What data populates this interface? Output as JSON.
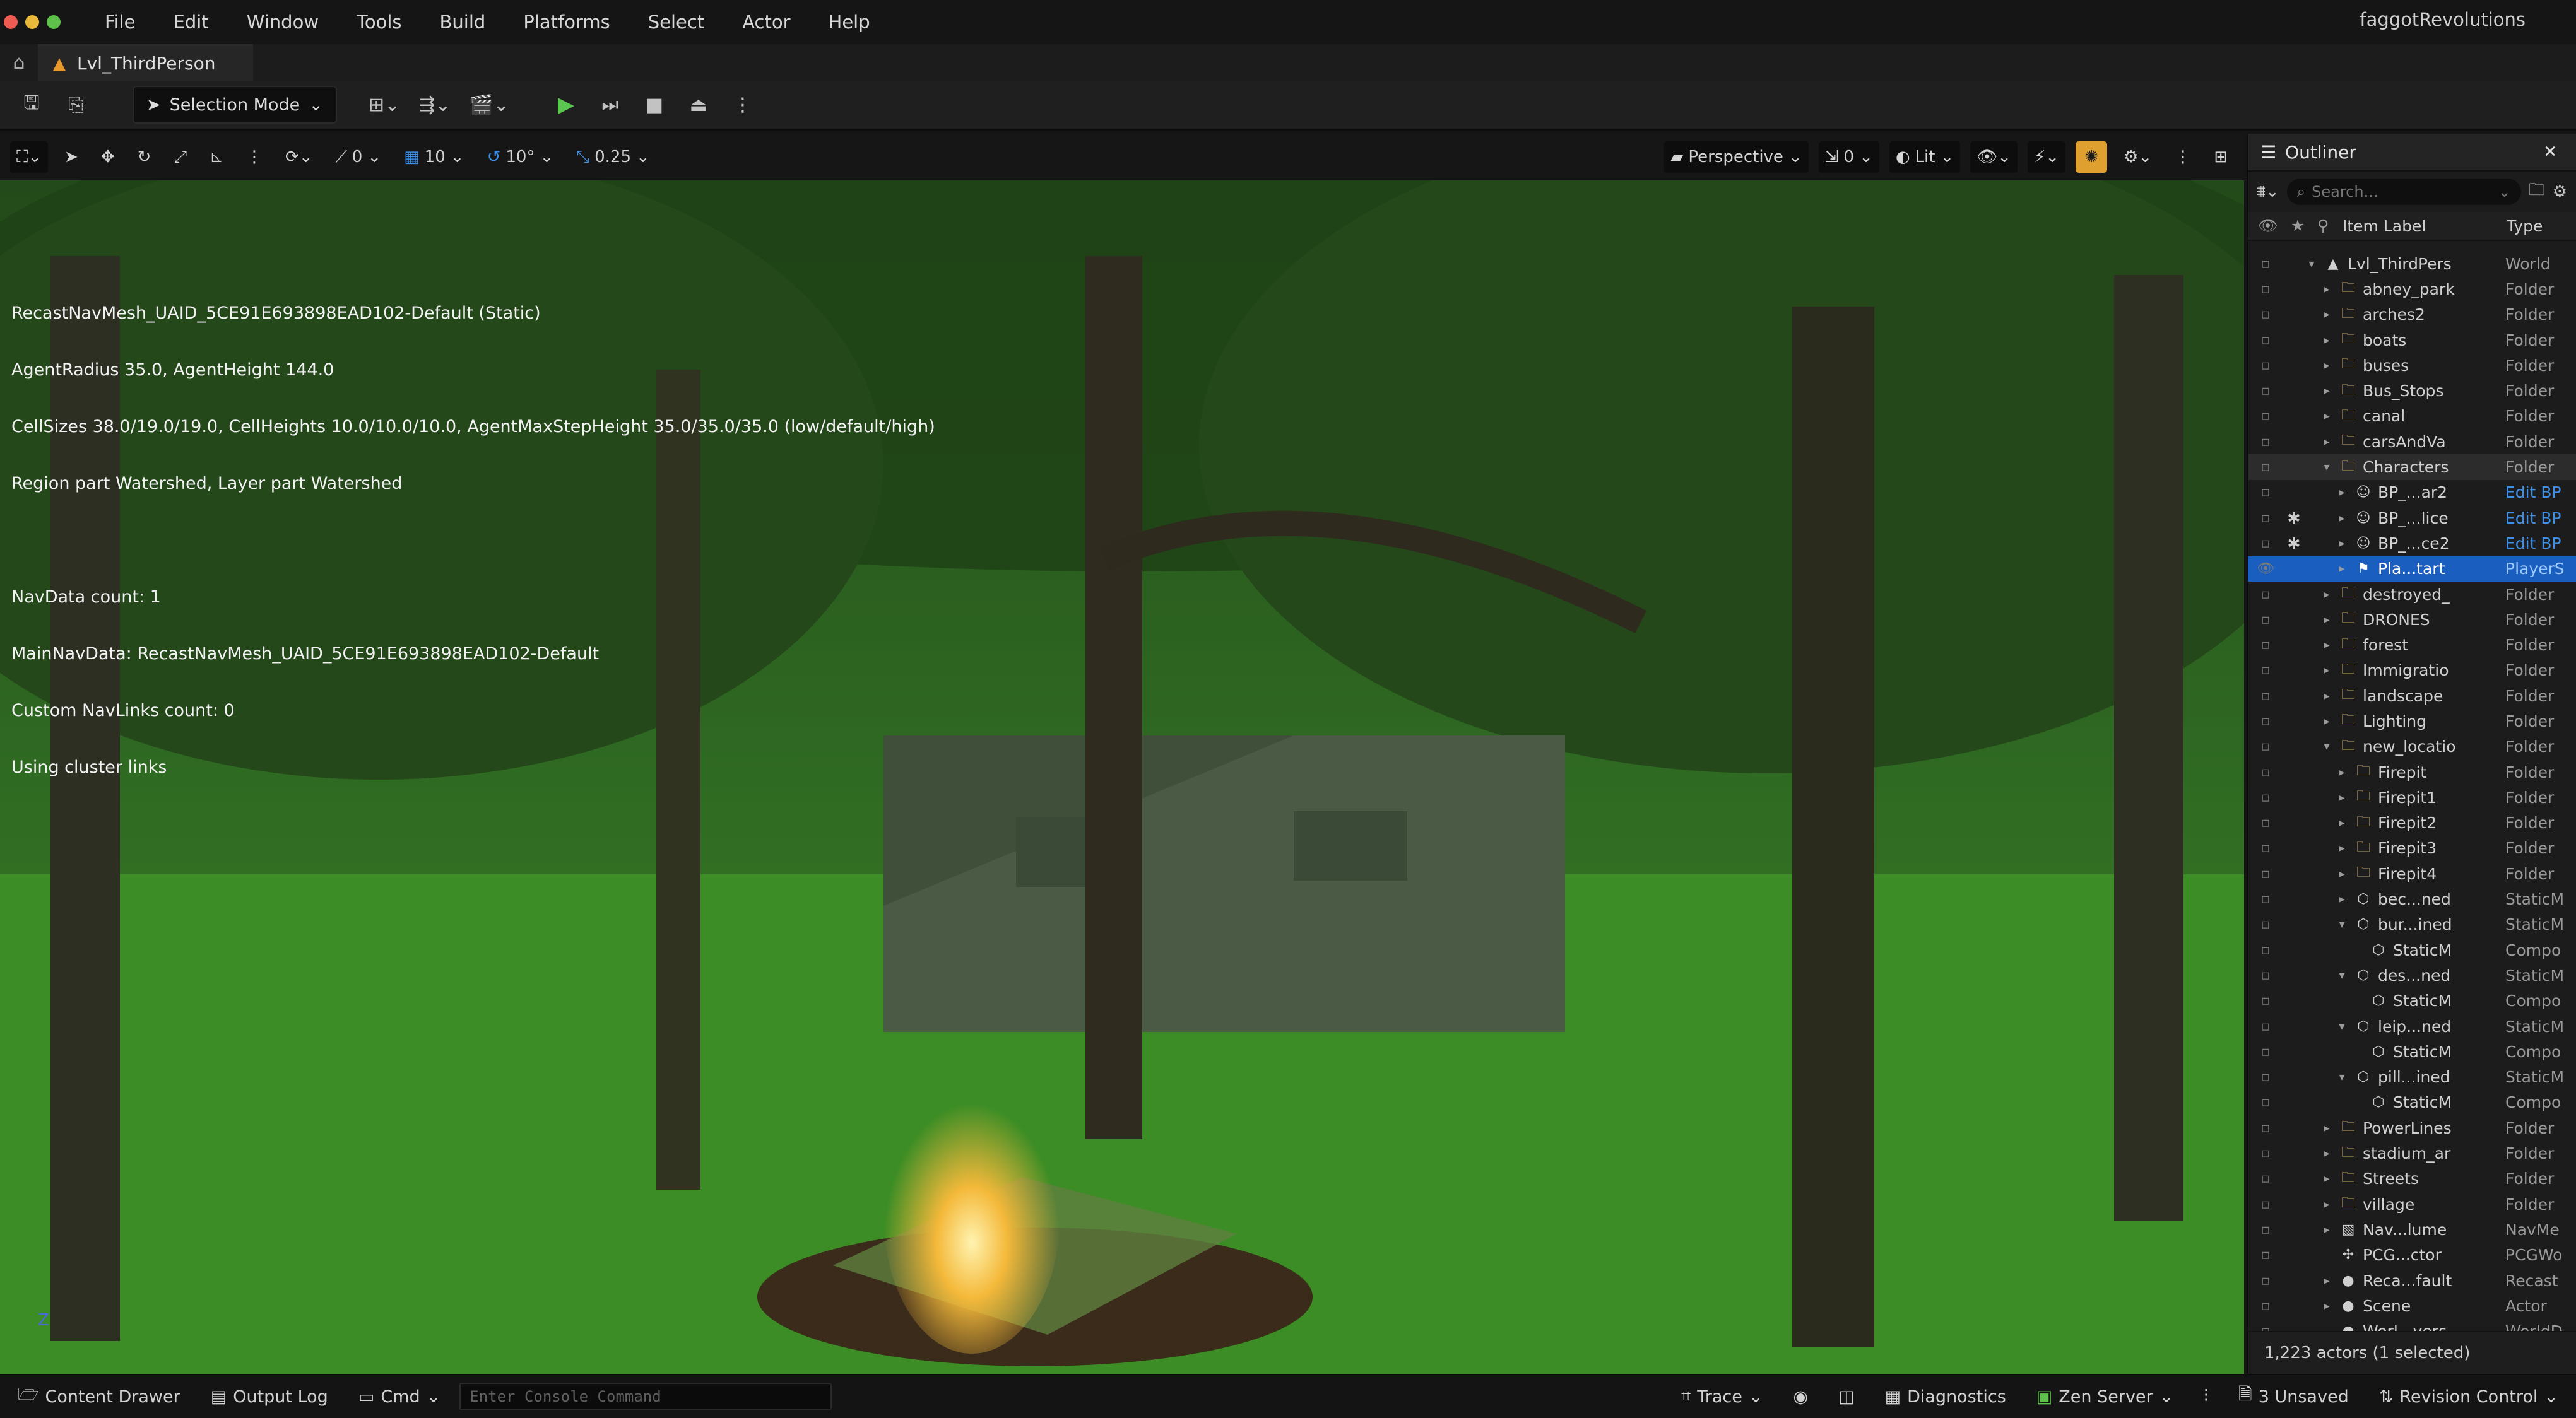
{
  "menubar": {
    "items": [
      "File",
      "Edit",
      "Window",
      "Tools",
      "Build",
      "Platforms",
      "Select",
      "Actor",
      "Help"
    ],
    "project": "faggotRevolutions"
  },
  "tabs": {
    "level_tab": "Lvl_ThirdPerson"
  },
  "toolbar": {
    "selection_mode": "Selection Mode"
  },
  "viewport_toolbar": {
    "rotation_snap": "0",
    "grid_snap": "10",
    "angle_snap": "10°",
    "scale_snap": "0.25",
    "view_mode": "Perspective",
    "camera_speed": "0",
    "lighting": "Lit"
  },
  "stats": [
    "RecastNavMesh_UAID_5CE91E693898EAD102-Default (Static)",
    "AgentRadius 35.0, AgentHeight 144.0",
    "CellSizes 38.0/19.0/19.0, CellHeights 10.0/10.0/10.0, AgentMaxStepHeight 35.0/35.0/35.0 (low/default/high)",
    "Region part Watershed, Layer part Watershed",
    "",
    "NavData count: 1",
    "MainNavData: RecastNavMesh_UAID_5CE91E693898EAD102-Default",
    "Custom NavLinks count: 0",
    "Using cluster links"
  ],
  "axis_label": "Z",
  "outliner": {
    "title": "Outliner",
    "search_placeholder": "Search...",
    "col_label": "Item Label",
    "col_type": "Type",
    "footer": "1,223 actors (1 selected)",
    "rows": [
      {
        "indent": 0,
        "arrow": "▾",
        "icon": "world",
        "label": "Lvl_ThirdPers",
        "type": "World",
        "star": "",
        "state": ""
      },
      {
        "indent": 1,
        "arrow": "▸",
        "icon": "folder",
        "label": "abney_park",
        "type": "Folder",
        "star": "",
        "state": ""
      },
      {
        "indent": 1,
        "arrow": "▸",
        "icon": "folder",
        "label": "arches2",
        "type": "Folder",
        "star": "",
        "state": ""
      },
      {
        "indent": 1,
        "arrow": "▸",
        "icon": "folder",
        "label": "boats",
        "type": "Folder",
        "star": "",
        "state": ""
      },
      {
        "indent": 1,
        "arrow": "▸",
        "icon": "folder",
        "label": "buses",
        "type": "Folder",
        "star": "",
        "state": ""
      },
      {
        "indent": 1,
        "arrow": "▸",
        "icon": "folder",
        "label": "Bus_Stops",
        "type": "Folder",
        "star": "",
        "state": ""
      },
      {
        "indent": 1,
        "arrow": "▸",
        "icon": "folder",
        "label": "canal",
        "type": "Folder",
        "star": "",
        "state": ""
      },
      {
        "indent": 1,
        "arrow": "▸",
        "icon": "folder",
        "label": "carsAndVa",
        "type": "Folder",
        "star": "",
        "state": ""
      },
      {
        "indent": 1,
        "arrow": "▾",
        "icon": "folder",
        "label": "Characters",
        "type": "Folder",
        "star": "",
        "state": "hi"
      },
      {
        "indent": 2,
        "arrow": "▸",
        "icon": "pawn",
        "label": "BP_...ar2",
        "type": "Edit BP",
        "star": "",
        "state": ""
      },
      {
        "indent": 2,
        "arrow": "▸",
        "icon": "pawn",
        "label": "BP_...lice",
        "type": "Edit BP",
        "star": "✱",
        "state": ""
      },
      {
        "indent": 2,
        "arrow": "▸",
        "icon": "pawn",
        "label": "BP_...ce2",
        "type": "Edit BP",
        "star": "✱",
        "state": ""
      },
      {
        "indent": 2,
        "arrow": "▸",
        "icon": "start",
        "label": "Pla...tart",
        "type": "PlayerS",
        "star": "",
        "state": "sel"
      },
      {
        "indent": 1,
        "arrow": "▸",
        "icon": "folder",
        "label": "destroyed_",
        "type": "Folder",
        "star": "",
        "state": ""
      },
      {
        "indent": 1,
        "arrow": "▸",
        "icon": "folder",
        "label": "DRONES",
        "type": "Folder",
        "star": "",
        "state": ""
      },
      {
        "indent": 1,
        "arrow": "▸",
        "icon": "folder",
        "label": "forest",
        "type": "Folder",
        "star": "",
        "state": ""
      },
      {
        "indent": 1,
        "arrow": "▸",
        "icon": "folder",
        "label": "Immigratio",
        "type": "Folder",
        "star": "",
        "state": ""
      },
      {
        "indent": 1,
        "arrow": "▸",
        "icon": "folder",
        "label": "landscape",
        "type": "Folder",
        "star": "",
        "state": ""
      },
      {
        "indent": 1,
        "arrow": "▸",
        "icon": "folder",
        "label": "Lighting",
        "type": "Folder",
        "star": "",
        "state": ""
      },
      {
        "indent": 1,
        "arrow": "▾",
        "icon": "folder",
        "label": "new_locatio",
        "type": "Folder",
        "star": "",
        "state": ""
      },
      {
        "indent": 2,
        "arrow": "▸",
        "icon": "folder",
        "label": "Firepit",
        "type": "Folder",
        "star": "",
        "state": ""
      },
      {
        "indent": 2,
        "arrow": "▸",
        "icon": "folder",
        "label": "Firepit1",
        "type": "Folder",
        "star": "",
        "state": ""
      },
      {
        "indent": 2,
        "arrow": "▸",
        "icon": "folder",
        "label": "Firepit2",
        "type": "Folder",
        "star": "",
        "state": ""
      },
      {
        "indent": 2,
        "arrow": "▸",
        "icon": "folder",
        "label": "Firepit3",
        "type": "Folder",
        "star": "",
        "state": ""
      },
      {
        "indent": 2,
        "arrow": "▸",
        "icon": "folder",
        "label": "Firepit4",
        "type": "Folder",
        "star": "",
        "state": ""
      },
      {
        "indent": 2,
        "arrow": "▸",
        "icon": "mesh",
        "label": "bec...ned",
        "type": "StaticM",
        "star": "",
        "state": ""
      },
      {
        "indent": 2,
        "arrow": "▾",
        "icon": "mesh",
        "label": "bur...ined",
        "type": "StaticM",
        "star": "",
        "state": ""
      },
      {
        "indent": 3,
        "arrow": "",
        "icon": "mesh",
        "label": "StaticM",
        "type": "Compo",
        "star": "",
        "state": ""
      },
      {
        "indent": 2,
        "arrow": "▾",
        "icon": "mesh",
        "label": "des...ned",
        "type": "StaticM",
        "star": "",
        "state": ""
      },
      {
        "indent": 3,
        "arrow": "",
        "icon": "mesh",
        "label": "StaticM",
        "type": "Compo",
        "star": "",
        "state": ""
      },
      {
        "indent": 2,
        "arrow": "▾",
        "icon": "mesh",
        "label": "leip...ned",
        "type": "StaticM",
        "star": "",
        "state": ""
      },
      {
        "indent": 3,
        "arrow": "",
        "icon": "mesh",
        "label": "StaticM",
        "type": "Compo",
        "star": "",
        "state": ""
      },
      {
        "indent": 2,
        "arrow": "▾",
        "icon": "mesh",
        "label": "pill...ined",
        "type": "StaticM",
        "star": "",
        "state": ""
      },
      {
        "indent": 3,
        "arrow": "",
        "icon": "mesh",
        "label": "StaticM",
        "type": "Compo",
        "star": "",
        "state": ""
      },
      {
        "indent": 1,
        "arrow": "▸",
        "icon": "folder",
        "label": "PowerLines",
        "type": "Folder",
        "star": "",
        "state": ""
      },
      {
        "indent": 1,
        "arrow": "▸",
        "icon": "folder",
        "label": "stadium_ar",
        "type": "Folder",
        "star": "",
        "state": ""
      },
      {
        "indent": 1,
        "arrow": "▸",
        "icon": "folder",
        "label": "Streets",
        "type": "Folder",
        "star": "",
        "state": ""
      },
      {
        "indent": 1,
        "arrow": "▸",
        "icon": "folder",
        "label": "village",
        "type": "Folder",
        "star": "",
        "state": ""
      },
      {
        "indent": 1,
        "arrow": "▸",
        "icon": "navvolume",
        "label": "Nav...lume",
        "type": "NavMe",
        "star": "",
        "state": ""
      },
      {
        "indent": 1,
        "arrow": "",
        "icon": "pcg",
        "label": "PCG...ctor",
        "type": "PCGWo",
        "star": "",
        "state": ""
      },
      {
        "indent": 1,
        "arrow": "▸",
        "icon": "actor",
        "label": "Reca...fault",
        "type": "Recast",
        "star": "",
        "state": ""
      },
      {
        "indent": 1,
        "arrow": "▸",
        "icon": "actor",
        "label": "Scene",
        "type": "Actor",
        "star": "",
        "state": ""
      },
      {
        "indent": 1,
        "arrow": "",
        "icon": "actor",
        "label": "Worl...vers",
        "type": "WorldD",
        "star": "",
        "state": ""
      }
    ]
  },
  "statusbar": {
    "content_drawer": "Content Drawer",
    "output_log": "Output Log",
    "cmd": "Cmd",
    "console_placeholder": "Enter Console Command",
    "trace": "Trace",
    "diagnostics": "Diagnostics",
    "zen": "Zen Server",
    "unsaved": "3 Unsaved",
    "revision": "Revision Control"
  }
}
